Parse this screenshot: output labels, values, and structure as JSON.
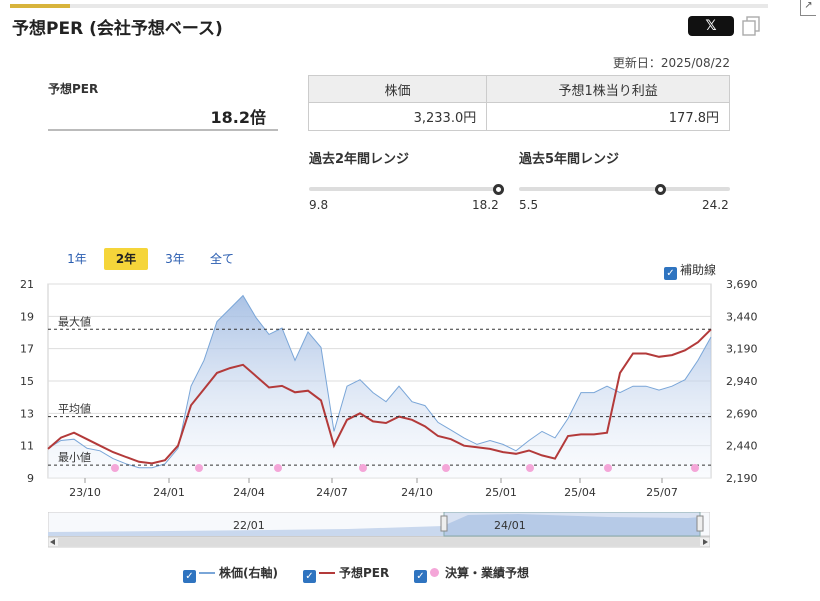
{
  "header": {
    "title": "予想PER (会社予想ベース)",
    "share_x_label": "𝕏",
    "updated": "更新日：2025/08/22"
  },
  "per": {
    "label": "予想PER",
    "value": "18.2倍"
  },
  "price_table": {
    "headers": [
      "株価",
      "予想1株当り利益"
    ],
    "values": [
      "3,233.0円",
      "177.8円"
    ]
  },
  "ranges": [
    {
      "label": "過去2年間レンジ",
      "min": "9.8",
      "max": "18.2",
      "position": 1.0
    },
    {
      "label": "過去5年間レンジ",
      "min": "5.5",
      "max": "24.2",
      "position": 0.674
    }
  ],
  "period_tabs": [
    "1年",
    "2年",
    "3年",
    "全て"
  ],
  "active_tab": "2年",
  "aux_line_label": "補助線",
  "chart_data": {
    "type": "line",
    "x_ticks": [
      "23/10",
      "24/01",
      "24/04",
      "24/07",
      "24/10",
      "25/01",
      "25/04",
      "25/07"
    ],
    "y_left_ticks": [
      "21",
      "19",
      "17",
      "15",
      "13",
      "11",
      "9"
    ],
    "y_left_range": [
      9,
      21
    ],
    "y_right_ticks": [
      "3,690",
      "3,440",
      "3,190",
      "2,940",
      "2,690",
      "2,440",
      "2,190"
    ],
    "y_right_range": [
      2190,
      3690
    ],
    "reference_lines": [
      {
        "label": "最大値",
        "value": 18.2
      },
      {
        "label": "平均値",
        "value": 12.8
      },
      {
        "label": "最小値",
        "value": 9.8
      }
    ],
    "series": [
      {
        "name": "予想PER",
        "color": "#b33a3a",
        "values": [
          10.8,
          11.5,
          11.8,
          11.4,
          11.0,
          10.6,
          10.3,
          10.0,
          9.9,
          10.1,
          11.0,
          13.5,
          14.5,
          15.5,
          15.8,
          16.0,
          15.3,
          14.6,
          14.7,
          14.3,
          14.4,
          13.8,
          11.0,
          12.6,
          13.0,
          12.5,
          12.4,
          12.8,
          12.6,
          12.2,
          11.6,
          11.4,
          11.0,
          10.9,
          10.8,
          10.6,
          10.5,
          10.7,
          10.4,
          10.2,
          11.6,
          11.7,
          11.7,
          11.8,
          15.5,
          16.7,
          16.7,
          16.5,
          16.6,
          16.9,
          17.4,
          18.2
        ]
      },
      {
        "name": "株価(右軸)",
        "color": "#7aa6d8",
        "values": [
          2420,
          2480,
          2490,
          2420,
          2400,
          2340,
          2300,
          2270,
          2270,
          2300,
          2420,
          2900,
          3100,
          3400,
          3500,
          3600,
          3430,
          3300,
          3350,
          3100,
          3320,
          3200,
          2550,
          2900,
          2950,
          2850,
          2780,
          2900,
          2780,
          2750,
          2620,
          2560,
          2500,
          2450,
          2480,
          2450,
          2400,
          2480,
          2550,
          2500,
          2650,
          2850,
          2850,
          2900,
          2850,
          2900,
          2900,
          2870,
          2900,
          2950,
          3100,
          3280
        ]
      }
    ],
    "earnings_markers": [
      "23/11",
      "24/02",
      "24/05",
      "24/08",
      "24/11",
      "25/02",
      "25/05",
      "25/08"
    ]
  },
  "navigator": {
    "ticks": [
      "22/01",
      "24/01"
    ]
  },
  "legend": [
    {
      "label": "株価(右軸)",
      "kind": "line",
      "color": "#7aa6d8"
    },
    {
      "label": "予想PER",
      "kind": "line",
      "color": "#b33a3a"
    },
    {
      "label": "決算・業績予想",
      "kind": "dot",
      "color": "#f4a6d8"
    }
  ]
}
